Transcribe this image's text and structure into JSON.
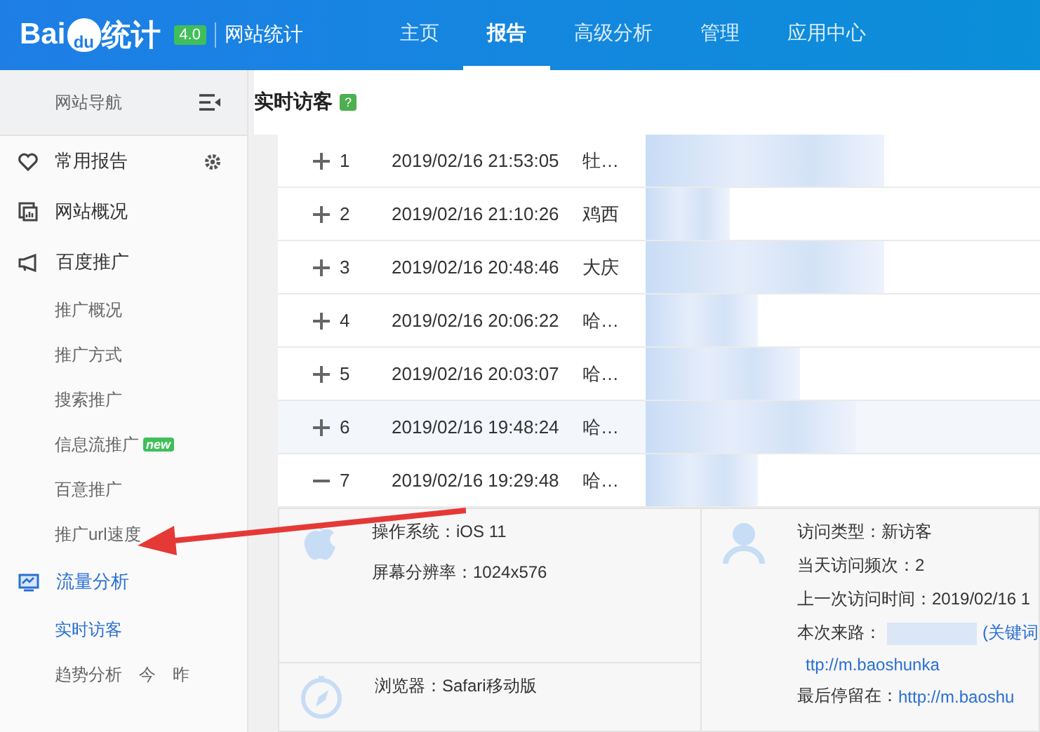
{
  "header": {
    "logo": {
      "prefix": "Bai",
      "paw": "du",
      "suffix": "统计"
    },
    "version": "4.0",
    "product": "网站统计",
    "nav": [
      {
        "label": "主页",
        "selected": false
      },
      {
        "label": "报告",
        "selected": true
      },
      {
        "label": "高级分析",
        "selected": false
      },
      {
        "label": "管理",
        "selected": false
      },
      {
        "label": "应用中心",
        "selected": false
      }
    ]
  },
  "sidebar": {
    "title": "网站导航",
    "items": [
      {
        "kind": "section",
        "label": "常用报告",
        "gear": true,
        "selected": false
      },
      {
        "kind": "section",
        "label": "网站概况",
        "gear": false,
        "selected": false
      },
      {
        "kind": "section",
        "label": "百度推广",
        "gear": false,
        "selected": false
      },
      {
        "kind": "sub",
        "label": "推广概况",
        "selected": false
      },
      {
        "kind": "sub",
        "label": "推广方式",
        "selected": false
      },
      {
        "kind": "sub",
        "label": "搜索推广",
        "selected": false
      },
      {
        "kind": "sub",
        "label": "信息流推广",
        "badge": "new",
        "selected": false
      },
      {
        "kind": "sub",
        "label": "百意推广",
        "selected": false
      },
      {
        "kind": "sub",
        "label": "推广url速度",
        "selected": false
      },
      {
        "kind": "section",
        "label": "流量分析",
        "gear": false,
        "selected": true
      },
      {
        "kind": "sub",
        "label": "实时访客",
        "selected": true
      },
      {
        "kind": "sub",
        "label": "趋势分析",
        "links": [
          "今",
          "昨"
        ],
        "selected": false
      }
    ]
  },
  "main": {
    "title": "实时访客",
    "help": "?",
    "rows": [
      {
        "index": "1",
        "time": "2019/02/16 21:53:05",
        "region": "牡…",
        "expanded": false,
        "highlighted": false
      },
      {
        "index": "2",
        "time": "2019/02/16 21:10:26",
        "region": "鸡西",
        "expanded": false,
        "highlighted": false
      },
      {
        "index": "3",
        "time": "2019/02/16 20:48:46",
        "region": "大庆",
        "expanded": false,
        "highlighted": false
      },
      {
        "index": "4",
        "time": "2019/02/16 20:06:22",
        "region": "哈…",
        "expanded": false,
        "highlighted": false
      },
      {
        "index": "5",
        "time": "2019/02/16 20:03:07",
        "region": "哈…",
        "expanded": false,
        "highlighted": false
      },
      {
        "index": "6",
        "time": "2019/02/16 19:48:24",
        "region": "哈…",
        "expanded": false,
        "highlighted": true
      },
      {
        "index": "7",
        "time": "2019/02/16 19:29:48",
        "region": "哈…",
        "expanded": true,
        "highlighted": false
      }
    ],
    "detail": {
      "left": [
        {
          "kind": "os",
          "lines": [
            "操作系统：iOS 11",
            "屏幕分辨率：1024x576"
          ]
        },
        {
          "kind": "browser",
          "lines": [
            "浏览器：Safari移动版"
          ]
        }
      ],
      "right": [
        {
          "kind": "text",
          "label": "访问类型：新访客"
        },
        {
          "kind": "text",
          "label": "当天访问频次：2"
        },
        {
          "kind": "text",
          "label": "上一次访问时间：2019/02/16 1"
        },
        {
          "kind": "source",
          "label": "本次来路：",
          "link": "(关键词"
        },
        {
          "kind": "link",
          "label": "ttp://m.baoshunka"
        },
        {
          "kind": "text-link",
          "label": "最后停留在：",
          "link": "http://m.baoshu"
        }
      ]
    }
  }
}
